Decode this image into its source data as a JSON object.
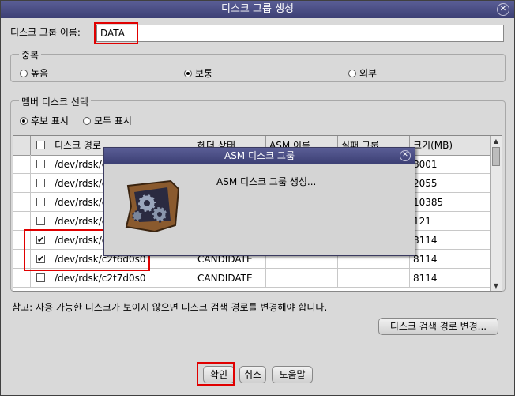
{
  "window": {
    "title": "디스크 그룹 생성"
  },
  "disk_group_name": {
    "label": "디스크 그룹 이름:",
    "value": "DATA"
  },
  "redundancy": {
    "legend": "중복",
    "options": [
      {
        "label": "높음",
        "selected": false
      },
      {
        "label": "보통",
        "selected": true
      },
      {
        "label": "외부",
        "selected": false
      }
    ]
  },
  "members": {
    "legend": "멤버 디스크 선택",
    "filters": [
      {
        "label": "후보 표시",
        "selected": true
      },
      {
        "label": "모두 표시",
        "selected": false
      }
    ],
    "columns": [
      "",
      "디스크 경로",
      "헤더 상태",
      "ASM 이름",
      "실패 그룹",
      "크기(MB)"
    ],
    "rows": [
      {
        "checked": false,
        "path": "/dev/rdsk/c",
        "status": "",
        "asm": "",
        "fail": "",
        "size": "8001"
      },
      {
        "checked": false,
        "path": "/dev/rdsk/c",
        "status": "",
        "asm": "",
        "fail": "",
        "size": "2055"
      },
      {
        "checked": false,
        "path": "/dev/rdsk/c",
        "status": "",
        "asm": "",
        "fail": "",
        "size": "10385"
      },
      {
        "checked": false,
        "path": "/dev/rdsk/c",
        "status": "",
        "asm": "",
        "fail": "",
        "size": "121"
      },
      {
        "checked": true,
        "path": "/dev/rdsk/c",
        "status": "",
        "asm": "",
        "fail": "",
        "size": "8114"
      },
      {
        "checked": true,
        "path": "/dev/rdsk/c2t6d0s0",
        "status": "CANDIDATE",
        "asm": "",
        "fail": "",
        "size": "8114"
      },
      {
        "checked": false,
        "path": "/dev/rdsk/c2t7d0s0",
        "status": "CANDIDATE",
        "asm": "",
        "fail": "",
        "size": "8114"
      }
    ]
  },
  "note": "참고: 사용 가능한 디스크가 보이지 않으면 디스크 검색 경로를 변경해야 합니다.",
  "buttons": {
    "change_path": "디스크 검색 경로 변경...",
    "ok": "확인",
    "cancel": "취소",
    "help": "도움말"
  },
  "progress_dialog": {
    "title": "ASM 디스크 그룹",
    "message": "ASM 디스크 그룹 생성...",
    "icon": "gears-icon"
  },
  "colors": {
    "highlight": "#e00000",
    "titlebar": "#4a4d85"
  }
}
